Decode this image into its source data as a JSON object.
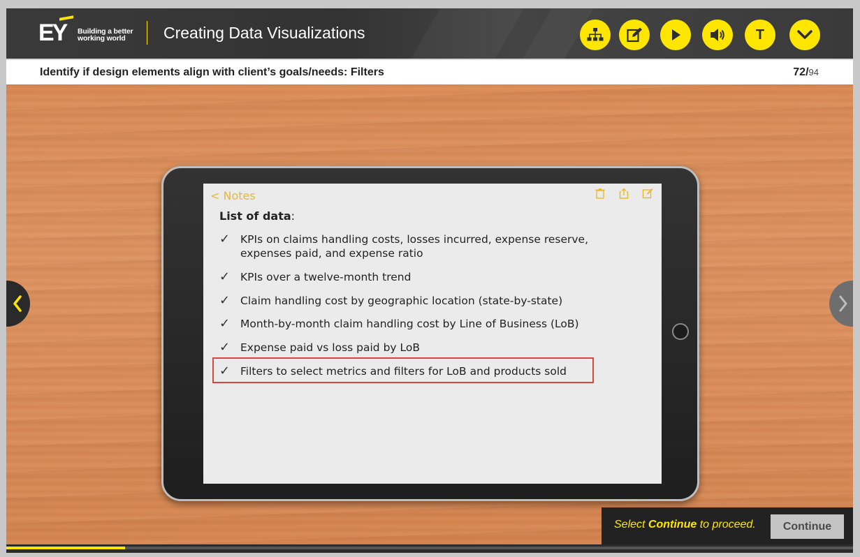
{
  "header": {
    "brand": "EY",
    "tagline_line1": "Building a better",
    "tagline_line2": "working world",
    "title": "Creating Data Visualizations",
    "buttons": [
      {
        "name": "sitemap",
        "icon": "sitemap-icon"
      },
      {
        "name": "notes",
        "icon": "edit-note-icon"
      },
      {
        "name": "play",
        "icon": "play-icon"
      },
      {
        "name": "audio",
        "icon": "speaker-icon"
      },
      {
        "name": "transcript",
        "icon": "t-letter-icon",
        "label": "T"
      },
      {
        "name": "menu",
        "icon": "chevron-down-icon"
      }
    ]
  },
  "slide": {
    "title": "Identify if design elements align with client’s goals/needs: Filters",
    "page_current": "72",
    "page_separator": "/",
    "page_total": "94"
  },
  "notes": {
    "back_label": "< Notes",
    "heading": "List of data",
    "heading_colon": ":",
    "check_glyph": "✓",
    "items": [
      {
        "text": "KPIs on claims handling costs, losses incurred, expense reserve, expenses paid, and expense ratio"
      },
      {
        "text": "KPIs over a twelve-month trend"
      },
      {
        "text": "Claim handling cost by geographic location (state-by-state)"
      },
      {
        "text": "Month-by-month claim handling cost by Line of Business (LoB)"
      },
      {
        "text": "Expense paid vs loss paid by LoB"
      },
      {
        "text": "Filters to select metrics and filters for LoB and products sold",
        "highlighted": true
      }
    ]
  },
  "footer": {
    "proceed_prefix": "Select ",
    "proceed_bold": "Continue",
    "proceed_suffix": " to proceed.",
    "continue_label": "Continue",
    "progress": 0.14
  },
  "colors": {
    "accent": "#ffe600",
    "highlight_border": "#d9453a",
    "notes_accent": "#e8b92e"
  }
}
